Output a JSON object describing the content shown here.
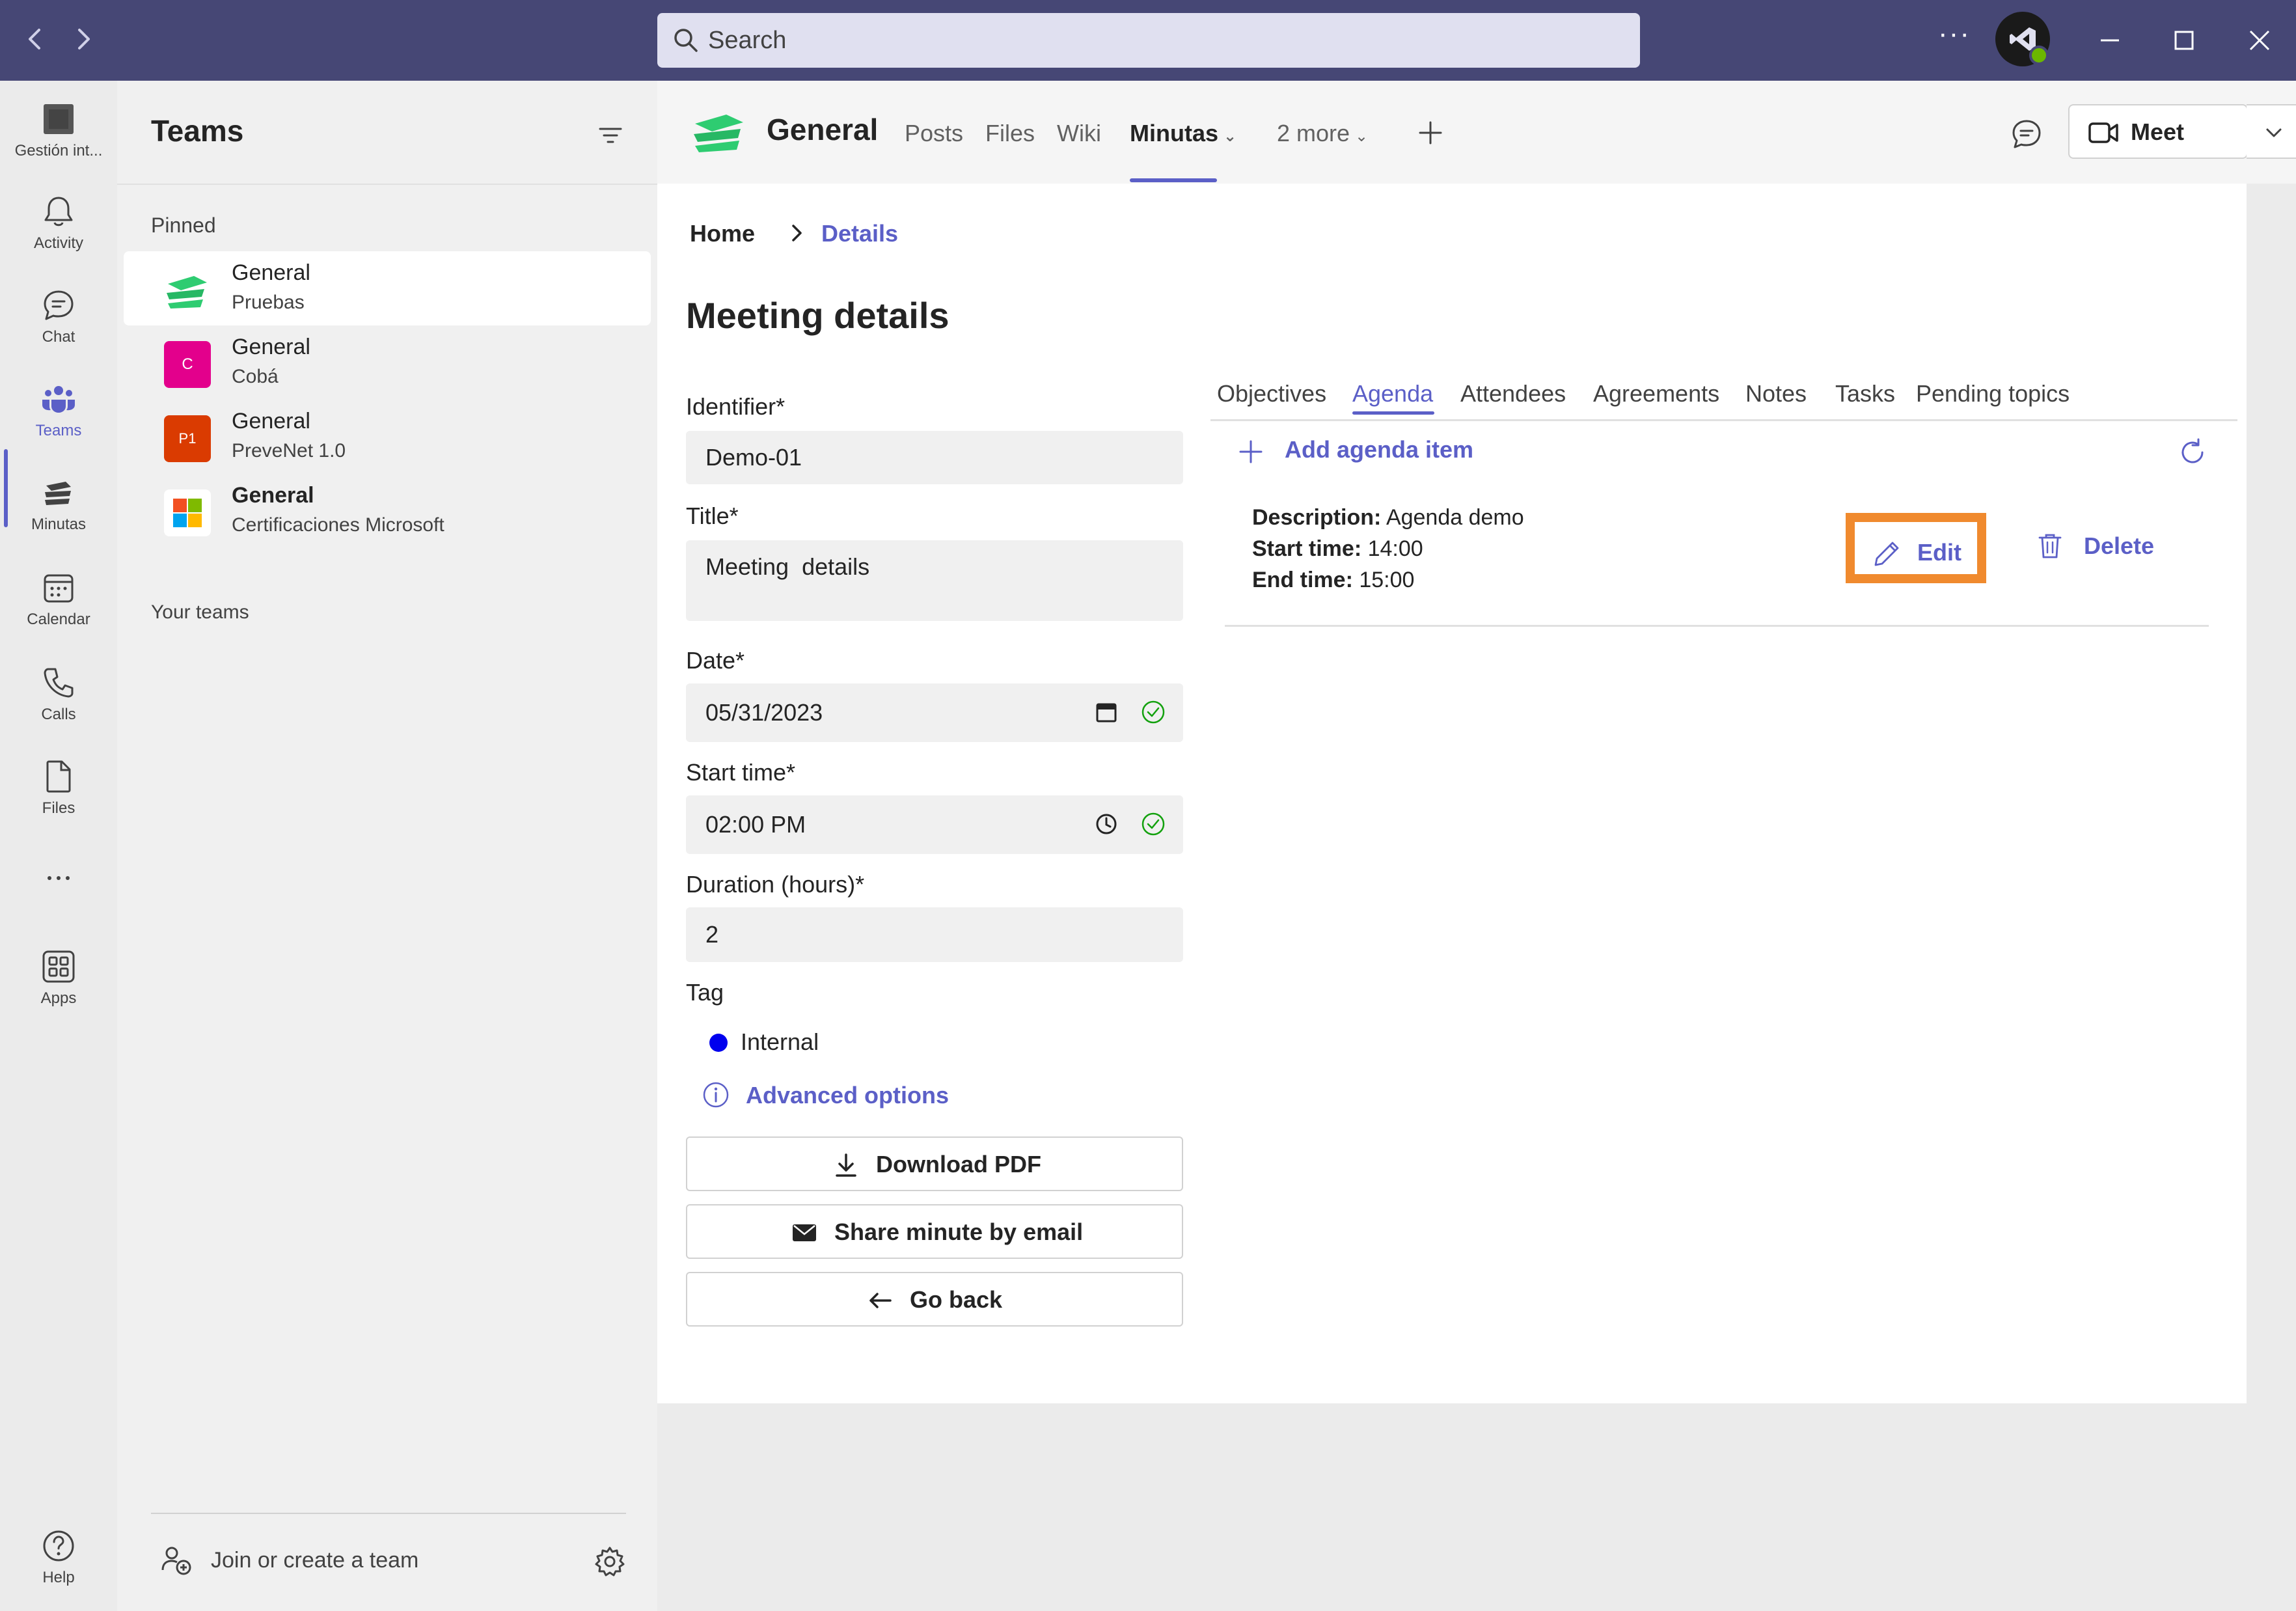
{
  "titlebar": {
    "search_placeholder": "Search",
    "more_label": "···",
    "presence_color": "#6bb700",
    "bar_color": "#464775"
  },
  "rail": {
    "items": [
      {
        "label": "Gestión int...",
        "icon": "app-tile-icon"
      },
      {
        "label": "Activity",
        "icon": "bell-icon"
      },
      {
        "label": "Chat",
        "icon": "chat-icon"
      },
      {
        "label": "Teams",
        "icon": "teams-icon",
        "active": true
      },
      {
        "label": "Minutas",
        "icon": "minutas-icon"
      },
      {
        "label": "Calendar",
        "icon": "calendar-icon"
      },
      {
        "label": "Calls",
        "icon": "phone-icon"
      },
      {
        "label": "Files",
        "icon": "file-icon"
      },
      {
        "label": "···",
        "icon": "more-icon"
      },
      {
        "label": "Apps",
        "icon": "apps-icon"
      },
      {
        "label": "Help",
        "icon": "help-icon"
      }
    ]
  },
  "teams_panel": {
    "title": "Teams",
    "pinned_label": "Pinned",
    "pinned": [
      {
        "name": "General",
        "sub": "Pruebas",
        "selected": true,
        "icon_color": "#2ecc71"
      },
      {
        "name": "General",
        "sub": "Cobá",
        "icon_color": "#e3008c",
        "icon_text": "C"
      },
      {
        "name": "General",
        "sub": "PreveNet 1.0",
        "icon_color": "#da3b01",
        "icon_text": "P1"
      },
      {
        "name": "General",
        "sub": "Certificaciones Microsoft",
        "bold": true
      }
    ],
    "your_teams_label": "Your teams",
    "join_label": "Join or create a team"
  },
  "channel_header": {
    "name": "General",
    "tabs": [
      {
        "label": "Posts"
      },
      {
        "label": "Files"
      },
      {
        "label": "Wiki"
      },
      {
        "label": "Minutas",
        "active": true
      },
      {
        "label": "2 more"
      }
    ],
    "meet_label": "Meet"
  },
  "content": {
    "breadcrumb_home": "Home",
    "breadcrumb_current": "Details",
    "page_title": "Meeting details",
    "fields": {
      "identifier_label": "Identifier*",
      "identifier_value": "Demo-01",
      "title_label": "Title*",
      "title_value": "Meeting  details",
      "date_label": "Date*",
      "date_value": "05/31/2023",
      "start_label": "Start time*",
      "start_value": "02:00 PM",
      "duration_label": "Duration (hours)*",
      "duration_value": "2",
      "tag_label": "Tag",
      "tag_value": "Internal",
      "tag_color": "#0000ee"
    },
    "advanced_label": "Advanced options",
    "buttons": {
      "download": "Download PDF",
      "share": "Share minute by email",
      "back": "Go back"
    },
    "agenda_tabs": [
      {
        "label": "Objectives"
      },
      {
        "label": "Agenda",
        "active": true
      },
      {
        "label": "Attendees"
      },
      {
        "label": "Agreements"
      },
      {
        "label": "Notes"
      },
      {
        "label": "Tasks"
      },
      {
        "label": "Pending topics"
      }
    ],
    "add_item_label": "Add agenda item",
    "agenda_item": {
      "description_key": "Description:",
      "description_val": "Agenda demo",
      "start_key": "Start time:",
      "start_val": "14:00",
      "end_key": "End time:",
      "end_val": "15:00"
    },
    "edit_label": "Edit",
    "delete_label": "Delete",
    "accent_color": "#5b5fc7",
    "highlight_color": "#f08a2e"
  }
}
